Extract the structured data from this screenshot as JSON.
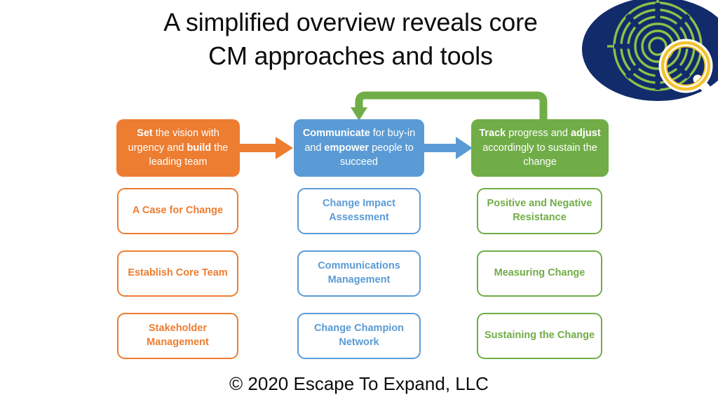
{
  "slide": {
    "title_line_1": "A simplified overview reveals core",
    "title_line_2": "CM approaches and tools",
    "footer": "© 2020 Escape To Expand, LLC"
  },
  "logo": {
    "name": "escape-to-expand-logo",
    "ellipse_color": "#122B6B",
    "maze_color": "#8CC04A",
    "glass_ring_color": "#F2C230",
    "glass_inner_color": "#FFFFFF"
  },
  "colors": {
    "orange": "#ED7D31",
    "blue": "#5B9BD5",
    "green": "#70AD47",
    "text_dark": "#0D0D0D",
    "white": "#FFFFFF"
  },
  "phases": [
    {
      "id": "set-vision",
      "color": "#ED7D31",
      "segments": [
        {
          "text": "Set",
          "bold": true
        },
        {
          "text": " the vision with urgency and ",
          "bold": false
        },
        {
          "text": "build",
          "bold": true
        },
        {
          "text": " the leading team",
          "bold": false
        }
      ],
      "plain_text": "Set the vision with urgency and build the leading team"
    },
    {
      "id": "communicate",
      "color": "#5B9BD5",
      "segments": [
        {
          "text": "Communicate",
          "bold": true
        },
        {
          "text": " for buy-in and ",
          "bold": false
        },
        {
          "text": "empower",
          "bold": true
        },
        {
          "text": " people to succeed",
          "bold": false
        }
      ],
      "plain_text": "Communicate for buy-in and empower people to succeed"
    },
    {
      "id": "track",
      "color": "#70AD47",
      "segments": [
        {
          "text": "Track",
          "bold": true
        },
        {
          "text": " progress and ",
          "bold": false
        },
        {
          "text": "adjust",
          "bold": true
        },
        {
          "text": " accordingly to sustain the change",
          "bold": false
        }
      ],
      "plain_text": "Track progress and adjust accordingly to sustain the change"
    }
  ],
  "columns": [
    {
      "id": "column-set-vision",
      "color": "#ED7D31",
      "tools": [
        "A Case for Change",
        "Establish Core Team",
        "Stakeholder Management"
      ]
    },
    {
      "id": "column-communicate",
      "color": "#5B9BD5",
      "tools": [
        "Change Impact Assessment",
        "Communications Management",
        "Change Champion Network"
      ]
    },
    {
      "id": "column-track",
      "color": "#70AD47",
      "tools": [
        "Positive and Negative Resistance",
        "Measuring Change",
        "Sustaining the Change"
      ]
    }
  ],
  "arrows": [
    {
      "id": "arrow-set-to-communicate",
      "color": "#ED7D31",
      "direction": "right"
    },
    {
      "id": "arrow-communicate-to-track",
      "color": "#5B9BD5",
      "direction": "right"
    },
    {
      "id": "arrow-track-feedback-to-communicate",
      "color": "#70AD47",
      "direction": "loop-back"
    }
  ]
}
